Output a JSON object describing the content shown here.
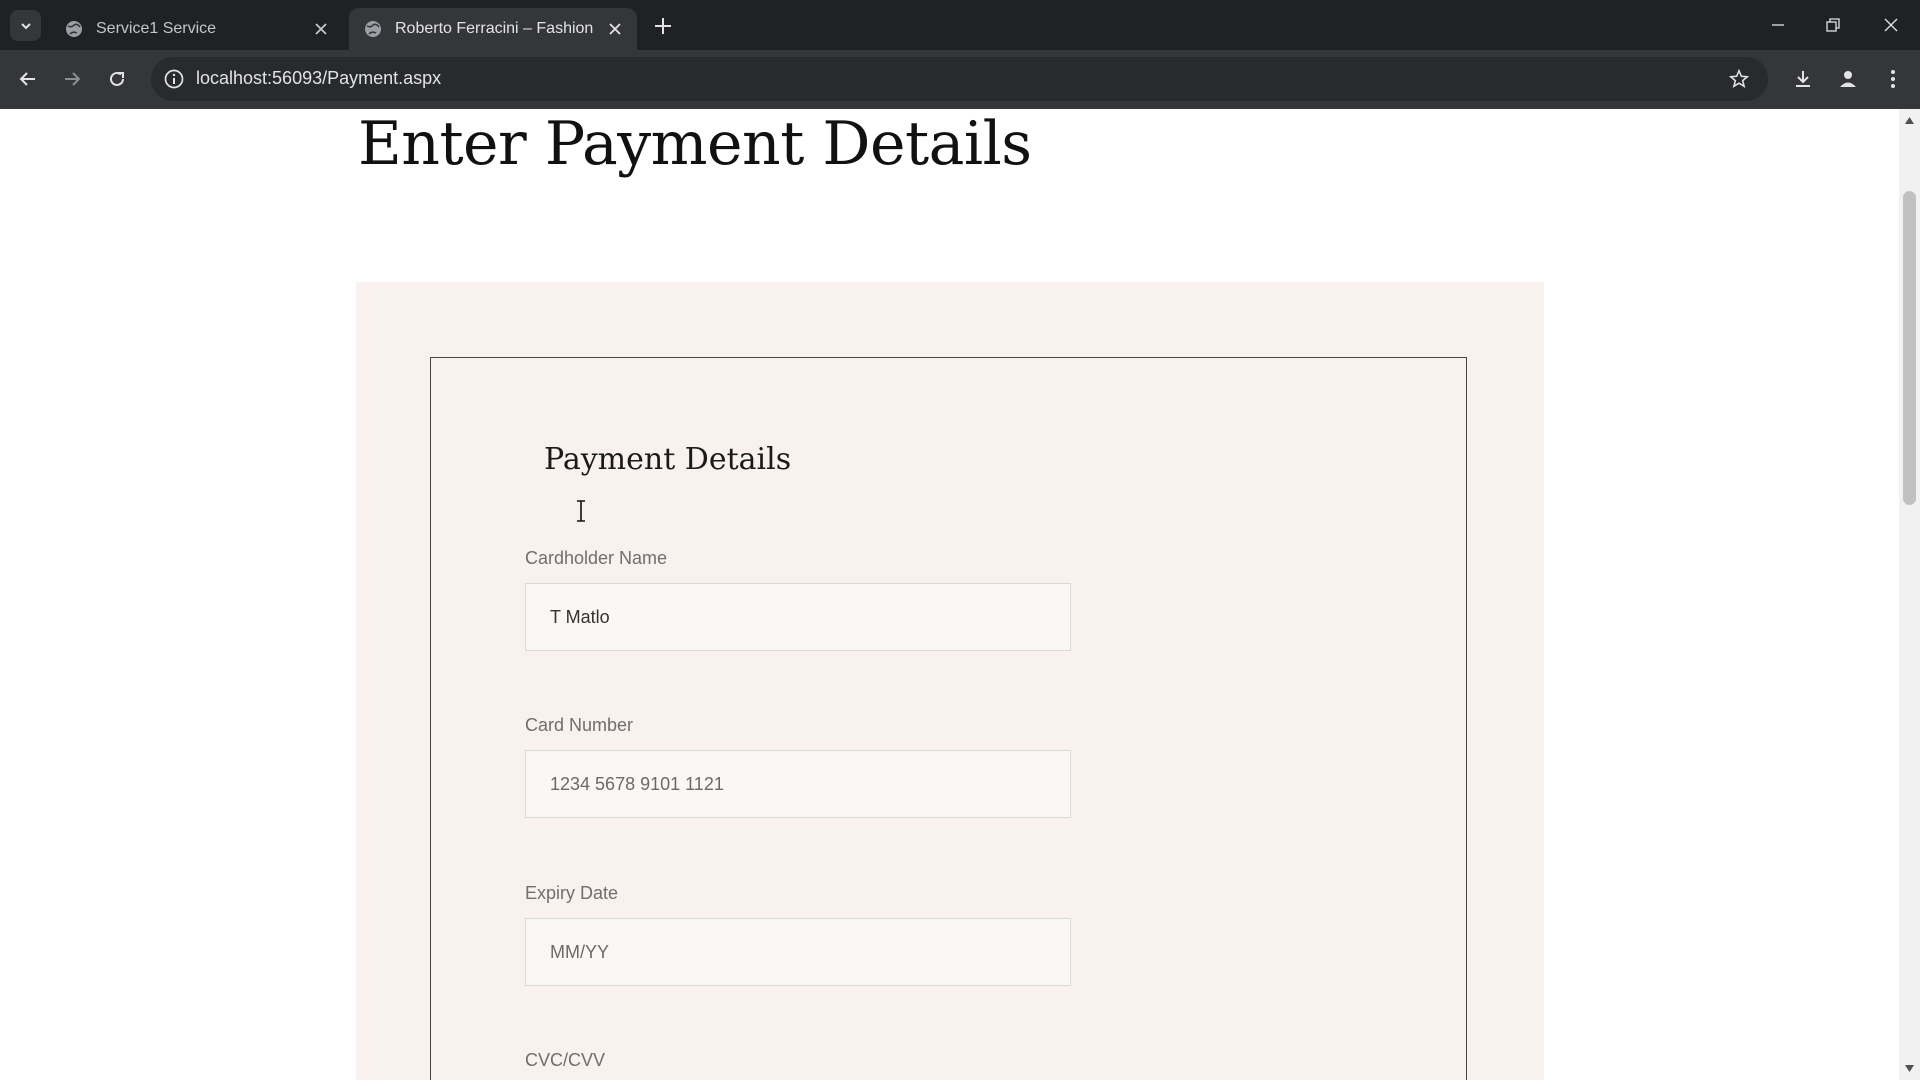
{
  "browser": {
    "tabs": [
      {
        "title": "Service1 Service",
        "active": false
      },
      {
        "title": "Roberto Ferracini – Fashion and",
        "active": true
      }
    ],
    "url": "localhost:56093/Payment.aspx"
  },
  "page": {
    "title": "Enter Payment Details",
    "card_title": "Payment Details",
    "fields": {
      "cardholder_name": {
        "label": "Cardholder Name",
        "value": "T Matlo"
      },
      "card_number": {
        "label": "Card Number",
        "placeholder": "1234 5678 9101 1121"
      },
      "expiry_date": {
        "label": "Expiry Date",
        "placeholder": "MM/YY"
      },
      "cvc": {
        "label": "CVC/CVV"
      }
    }
  },
  "colors": {
    "panel_background": "#f8f1ee",
    "browser_dark": "#202124"
  }
}
